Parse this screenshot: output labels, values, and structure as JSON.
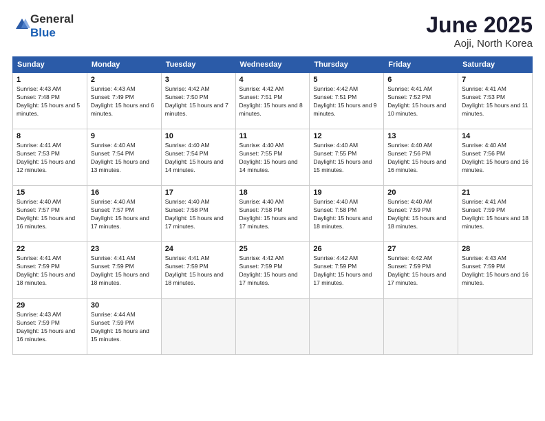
{
  "logo": {
    "general": "General",
    "blue": "Blue"
  },
  "title": "June 2025",
  "location": "Aoji, North Korea",
  "headers": [
    "Sunday",
    "Monday",
    "Tuesday",
    "Wednesday",
    "Thursday",
    "Friday",
    "Saturday"
  ],
  "weeks": [
    [
      {
        "day": "1",
        "sunrise": "4:43 AM",
        "sunset": "7:48 PM",
        "daylight": "15 hours and 5 minutes."
      },
      {
        "day": "2",
        "sunrise": "4:43 AM",
        "sunset": "7:49 PM",
        "daylight": "15 hours and 6 minutes."
      },
      {
        "day": "3",
        "sunrise": "4:42 AM",
        "sunset": "7:50 PM",
        "daylight": "15 hours and 7 minutes."
      },
      {
        "day": "4",
        "sunrise": "4:42 AM",
        "sunset": "7:51 PM",
        "daylight": "15 hours and 8 minutes."
      },
      {
        "day": "5",
        "sunrise": "4:42 AM",
        "sunset": "7:51 PM",
        "daylight": "15 hours and 9 minutes."
      },
      {
        "day": "6",
        "sunrise": "4:41 AM",
        "sunset": "7:52 PM",
        "daylight": "15 hours and 10 minutes."
      },
      {
        "day": "7",
        "sunrise": "4:41 AM",
        "sunset": "7:53 PM",
        "daylight": "15 hours and 11 minutes."
      }
    ],
    [
      {
        "day": "8",
        "sunrise": "4:41 AM",
        "sunset": "7:53 PM",
        "daylight": "15 hours and 12 minutes."
      },
      {
        "day": "9",
        "sunrise": "4:40 AM",
        "sunset": "7:54 PM",
        "daylight": "15 hours and 13 minutes."
      },
      {
        "day": "10",
        "sunrise": "4:40 AM",
        "sunset": "7:54 PM",
        "daylight": "15 hours and 14 minutes."
      },
      {
        "day": "11",
        "sunrise": "4:40 AM",
        "sunset": "7:55 PM",
        "daylight": "15 hours and 14 minutes."
      },
      {
        "day": "12",
        "sunrise": "4:40 AM",
        "sunset": "7:55 PM",
        "daylight": "15 hours and 15 minutes."
      },
      {
        "day": "13",
        "sunrise": "4:40 AM",
        "sunset": "7:56 PM",
        "daylight": "15 hours and 16 minutes."
      },
      {
        "day": "14",
        "sunrise": "4:40 AM",
        "sunset": "7:56 PM",
        "daylight": "15 hours and 16 minutes."
      }
    ],
    [
      {
        "day": "15",
        "sunrise": "4:40 AM",
        "sunset": "7:57 PM",
        "daylight": "15 hours and 16 minutes."
      },
      {
        "day": "16",
        "sunrise": "4:40 AM",
        "sunset": "7:57 PM",
        "daylight": "15 hours and 17 minutes."
      },
      {
        "day": "17",
        "sunrise": "4:40 AM",
        "sunset": "7:58 PM",
        "daylight": "15 hours and 17 minutes."
      },
      {
        "day": "18",
        "sunrise": "4:40 AM",
        "sunset": "7:58 PM",
        "daylight": "15 hours and 17 minutes."
      },
      {
        "day": "19",
        "sunrise": "4:40 AM",
        "sunset": "7:58 PM",
        "daylight": "15 hours and 18 minutes."
      },
      {
        "day": "20",
        "sunrise": "4:40 AM",
        "sunset": "7:59 PM",
        "daylight": "15 hours and 18 minutes."
      },
      {
        "day": "21",
        "sunrise": "4:41 AM",
        "sunset": "7:59 PM",
        "daylight": "15 hours and 18 minutes."
      }
    ],
    [
      {
        "day": "22",
        "sunrise": "4:41 AM",
        "sunset": "7:59 PM",
        "daylight": "15 hours and 18 minutes."
      },
      {
        "day": "23",
        "sunrise": "4:41 AM",
        "sunset": "7:59 PM",
        "daylight": "15 hours and 18 minutes."
      },
      {
        "day": "24",
        "sunrise": "4:41 AM",
        "sunset": "7:59 PM",
        "daylight": "15 hours and 18 minutes."
      },
      {
        "day": "25",
        "sunrise": "4:42 AM",
        "sunset": "7:59 PM",
        "daylight": "15 hours and 17 minutes."
      },
      {
        "day": "26",
        "sunrise": "4:42 AM",
        "sunset": "7:59 PM",
        "daylight": "15 hours and 17 minutes."
      },
      {
        "day": "27",
        "sunrise": "4:42 AM",
        "sunset": "7:59 PM",
        "daylight": "15 hours and 17 minutes."
      },
      {
        "day": "28",
        "sunrise": "4:43 AM",
        "sunset": "7:59 PM",
        "daylight": "15 hours and 16 minutes."
      }
    ],
    [
      {
        "day": "29",
        "sunrise": "4:43 AM",
        "sunset": "7:59 PM",
        "daylight": "15 hours and 16 minutes."
      },
      {
        "day": "30",
        "sunrise": "4:44 AM",
        "sunset": "7:59 PM",
        "daylight": "15 hours and 15 minutes."
      },
      null,
      null,
      null,
      null,
      null
    ]
  ]
}
